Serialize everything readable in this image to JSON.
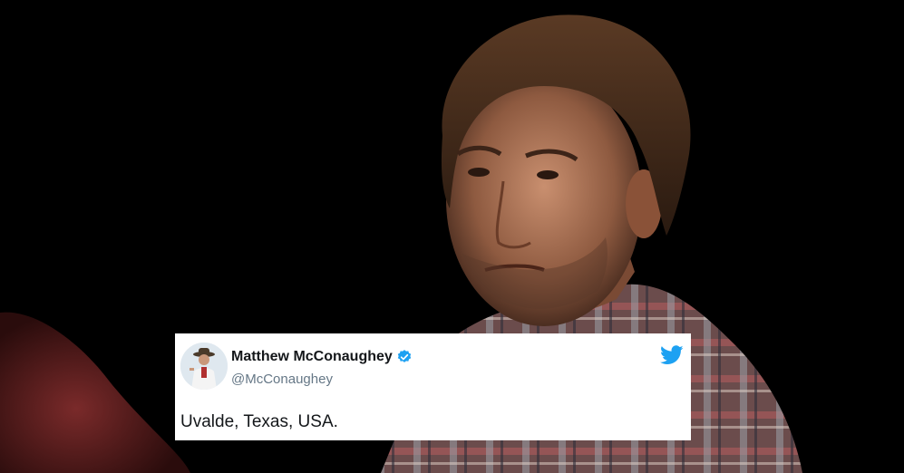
{
  "tweet": {
    "display_name": "Matthew McConaughey",
    "handle": "@McConaughey",
    "text": "Uvalde, Texas, USA.",
    "verified": true
  },
  "icons": {
    "verified": "verified-badge-icon",
    "brand": "twitter-bird-icon"
  },
  "colors": {
    "verified": "#1da1f2",
    "twitter_brand": "#1da1f2",
    "card_background": "#ffffff",
    "handle_text": "#657786"
  }
}
